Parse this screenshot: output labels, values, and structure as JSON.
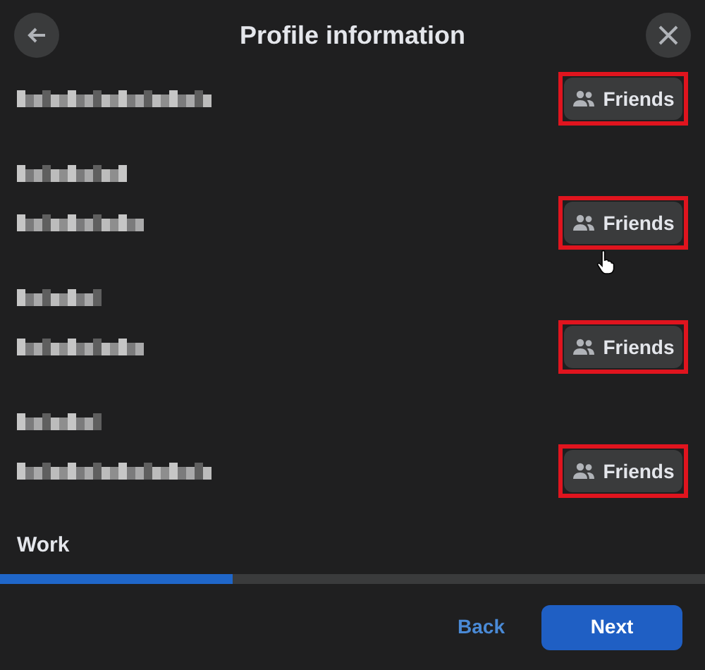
{
  "header": {
    "title": "Profile information"
  },
  "sections": [
    {
      "value": {
        "redacted": true
      },
      "audience": {
        "label": "Friends",
        "highlighted": true
      }
    },
    {
      "label": {
        "redacted": true
      },
      "value": {
        "redacted": true
      },
      "audience": {
        "label": "Friends",
        "highlighted": true
      }
    },
    {
      "label": {
        "redacted": true
      },
      "value": {
        "redacted": true
      },
      "audience": {
        "label": "Friends",
        "highlighted": true
      }
    },
    {
      "label": {
        "redacted": true
      },
      "value": {
        "redacted": true
      },
      "audience": {
        "label": "Friends",
        "highlighted": true
      }
    },
    {
      "label": {
        "text": "Work",
        "redacted": false
      }
    }
  ],
  "progress": {
    "level": 0.33
  },
  "footer": {
    "back": "Back",
    "next": "Next"
  }
}
